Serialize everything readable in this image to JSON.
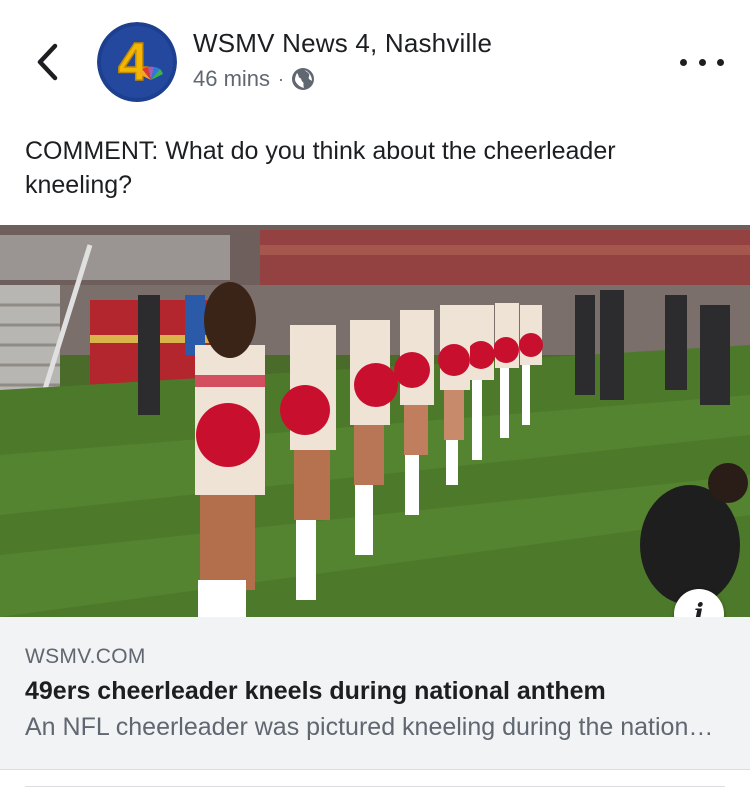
{
  "header": {
    "back_icon": "chevron-left-icon",
    "page_name": "WSMV News 4, Nashville",
    "avatar_label": "4",
    "time_ago": "46 mins",
    "separator": "·",
    "privacy_icon": "globe-icon",
    "more_icon": "more-horizontal-icon"
  },
  "post": {
    "text": "COMMENT: What do you think about the cheerleader kneeling?"
  },
  "image": {
    "info_label": "i"
  },
  "link_preview": {
    "domain": "WSMV.COM",
    "title": "49ers cheerleader kneels during national anthem",
    "description": "An NFL cheerleader was pictured kneeling during the national anthem"
  },
  "colors": {
    "text_primary": "#1c1e21",
    "text_secondary": "#606770",
    "preview_bg": "#f2f3f5",
    "avatar_blue": "#1d3f8f",
    "avatar_gold": "#f2b705",
    "uniform_red": "#c8102e"
  }
}
